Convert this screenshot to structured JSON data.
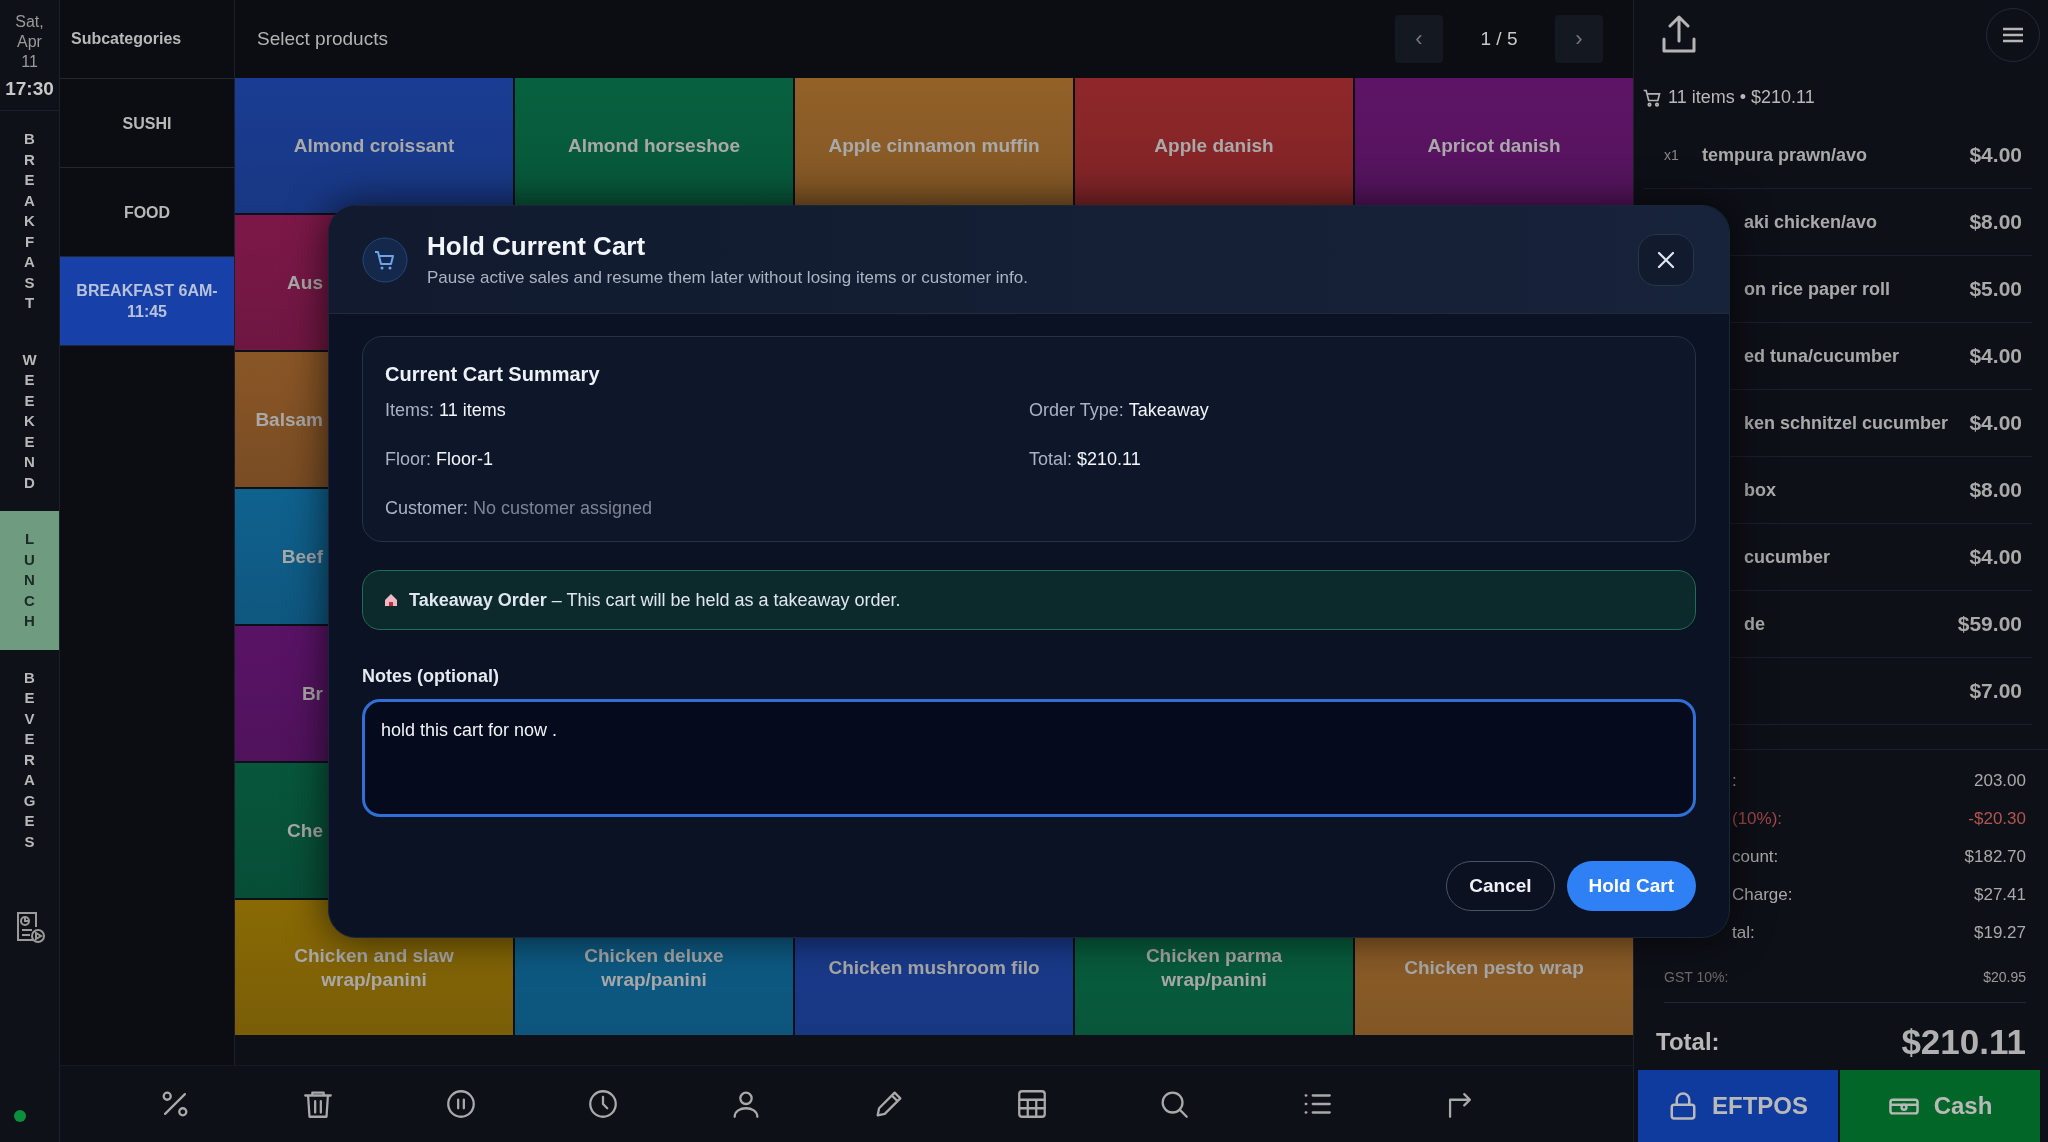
{
  "clock": {
    "date": "Sat, Apr 11",
    "time": "17:30"
  },
  "categories": [
    {
      "label": "BREAKFAST",
      "selected": false
    },
    {
      "label": "WEEKEND",
      "selected": false
    },
    {
      "label": "LUNCH",
      "selected": true
    },
    {
      "label": "BEVERAGES",
      "selected": false
    }
  ],
  "status": {
    "online": true
  },
  "subcategories": {
    "title": "Subcategories",
    "items": [
      {
        "label": "SUSHI",
        "selected": false
      },
      {
        "label": "FOOD",
        "selected": false
      },
      {
        "label": "BREAKFAST 6AM-11:45",
        "selected": true
      }
    ]
  },
  "products": {
    "title": "Select products",
    "pager": {
      "prev": "‹",
      "page": "1 / 5",
      "next": "›"
    },
    "rows": [
      [
        {
          "name": "Almond croissant",
          "color": "#1a3d93"
        },
        {
          "name": "Almond horseshoe",
          "color": "#07613f"
        },
        {
          "name": "Apple cinnamon muffin",
          "color": "#936128"
        },
        {
          "name": "Apple danish",
          "color": "#8f2729"
        },
        {
          "name": "Apricot danish",
          "color": "#5e1466"
        }
      ],
      [
        {
          "name": "Aus",
          "color": "#7d1848"
        }
      ],
      [
        {
          "name": "Balsam",
          "color": "#8a5626"
        }
      ],
      [
        {
          "name": "Beef",
          "color": "#0f628f"
        }
      ],
      [
        {
          "name": "Br",
          "color": "#5a1366"
        }
      ],
      [
        {
          "name": "Che",
          "color": "#07573c"
        }
      ],
      [
        {
          "name": "Chicken and slaw wrap/panini",
          "color": "#8a6a05"
        },
        {
          "name": "Chicken deluxe wrap/panini",
          "color": "#0d5f8a"
        },
        {
          "name": "Chicken mushroom filo",
          "color": "#1a3d93"
        },
        {
          "name": "Chicken parma wrap/panini",
          "color": "#07613f"
        },
        {
          "name": "Chicken pesto wrap",
          "color": "#936128"
        }
      ]
    ]
  },
  "cart": {
    "summary": "11 items • $210.11",
    "items": [
      {
        "qty": "x1",
        "name": "tempura prawn/avo",
        "price": "$4.00"
      },
      {
        "name": "aki chicken/avo",
        "price": "$8.00"
      },
      {
        "name": "on rice paper roll",
        "price": "$5.00"
      },
      {
        "name": "ed tuna/cucumber",
        "price": "$4.00"
      },
      {
        "name": "ken schnitzel cucumber",
        "price": "$4.00"
      },
      {
        "name": "box",
        "price": "$8.00"
      },
      {
        "name": "cucumber",
        "price": "$4.00"
      },
      {
        "name": "de",
        "price": "$59.00"
      },
      {
        "price": "$7.00"
      }
    ],
    "totals": [
      {
        "label": ":",
        "value": "203.00",
        "kind": "normal"
      },
      {
        "label": "(10%):",
        "value": "-$20.30",
        "kind": "discount"
      },
      {
        "label": "count:",
        "value": "$182.70",
        "kind": "normal"
      },
      {
        "label": "Charge:",
        "value": "$27.41",
        "kind": "normal"
      },
      {
        "label": "tal:",
        "value": "$19.27",
        "kind": "normal"
      },
      {
        "label": "GST 10%:",
        "value": "$20.95",
        "kind": "minor"
      }
    ],
    "total": {
      "label": "Total:",
      "value": "$210.11"
    },
    "payments": [
      {
        "label": "EFTPOS",
        "kind": "card"
      },
      {
        "label": "Cash",
        "kind": "cash"
      }
    ]
  },
  "dialog": {
    "title": "Hold Current Cart",
    "subtitle": "Pause active sales and resume them later without losing items or customer info.",
    "summary": {
      "title": "Current Cart Summary",
      "fields": [
        {
          "label": "Items:",
          "value": "11 items",
          "muted": false
        },
        {
          "label": "Order Type:",
          "value": "Takeaway",
          "muted": false
        },
        {
          "label": "Floor:",
          "value": "Floor-1",
          "muted": false
        },
        {
          "label": "Total:",
          "value": "$210.11",
          "muted": false
        },
        {
          "label": "Customer:",
          "value": "No customer assigned",
          "muted": true
        }
      ]
    },
    "notice": "**Takeaway Order** – This cart will be held as a takeaway order.",
    "notes": {
      "label": "Notes (optional)",
      "value": "hold this cart for now ."
    },
    "buttons": [
      {
        "label": "Cancel",
        "kind": "secondary"
      },
      {
        "label": "Hold Cart",
        "kind": "primary"
      }
    ]
  }
}
